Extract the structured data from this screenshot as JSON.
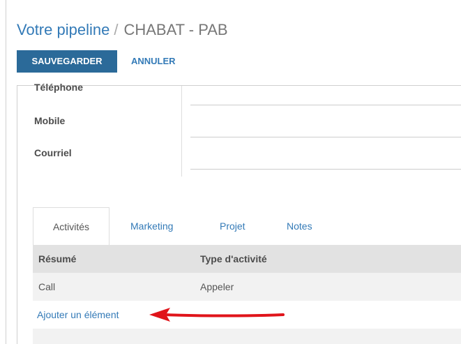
{
  "breadcrumb": {
    "parent": "Votre pipeline",
    "separator": "/",
    "current": "CHABAT - PAB"
  },
  "toolbar": {
    "save_label": "SAUVEGARDER",
    "cancel_label": "ANNULER"
  },
  "form": {
    "fields": [
      {
        "label": "Téléphone",
        "value": ""
      },
      {
        "label": "Mobile",
        "value": ""
      },
      {
        "label": "Courriel",
        "value": ""
      }
    ]
  },
  "tabs": [
    {
      "label": "Activités",
      "active": true
    },
    {
      "label": "Marketing",
      "active": false
    },
    {
      "label": "Projet",
      "active": false
    },
    {
      "label": "Notes",
      "active": false
    }
  ],
  "table": {
    "headers": [
      "Résumé",
      "Type d'activité"
    ],
    "rows": [
      [
        "Call",
        "Appeler"
      ]
    ],
    "add_label": "Ajouter un élément"
  },
  "colors": {
    "accent": "#337ab7",
    "primary_button": "#2b6a99",
    "arrow": "#e0141a"
  },
  "icons": {
    "annotation": "red-arrow-left-icon"
  }
}
